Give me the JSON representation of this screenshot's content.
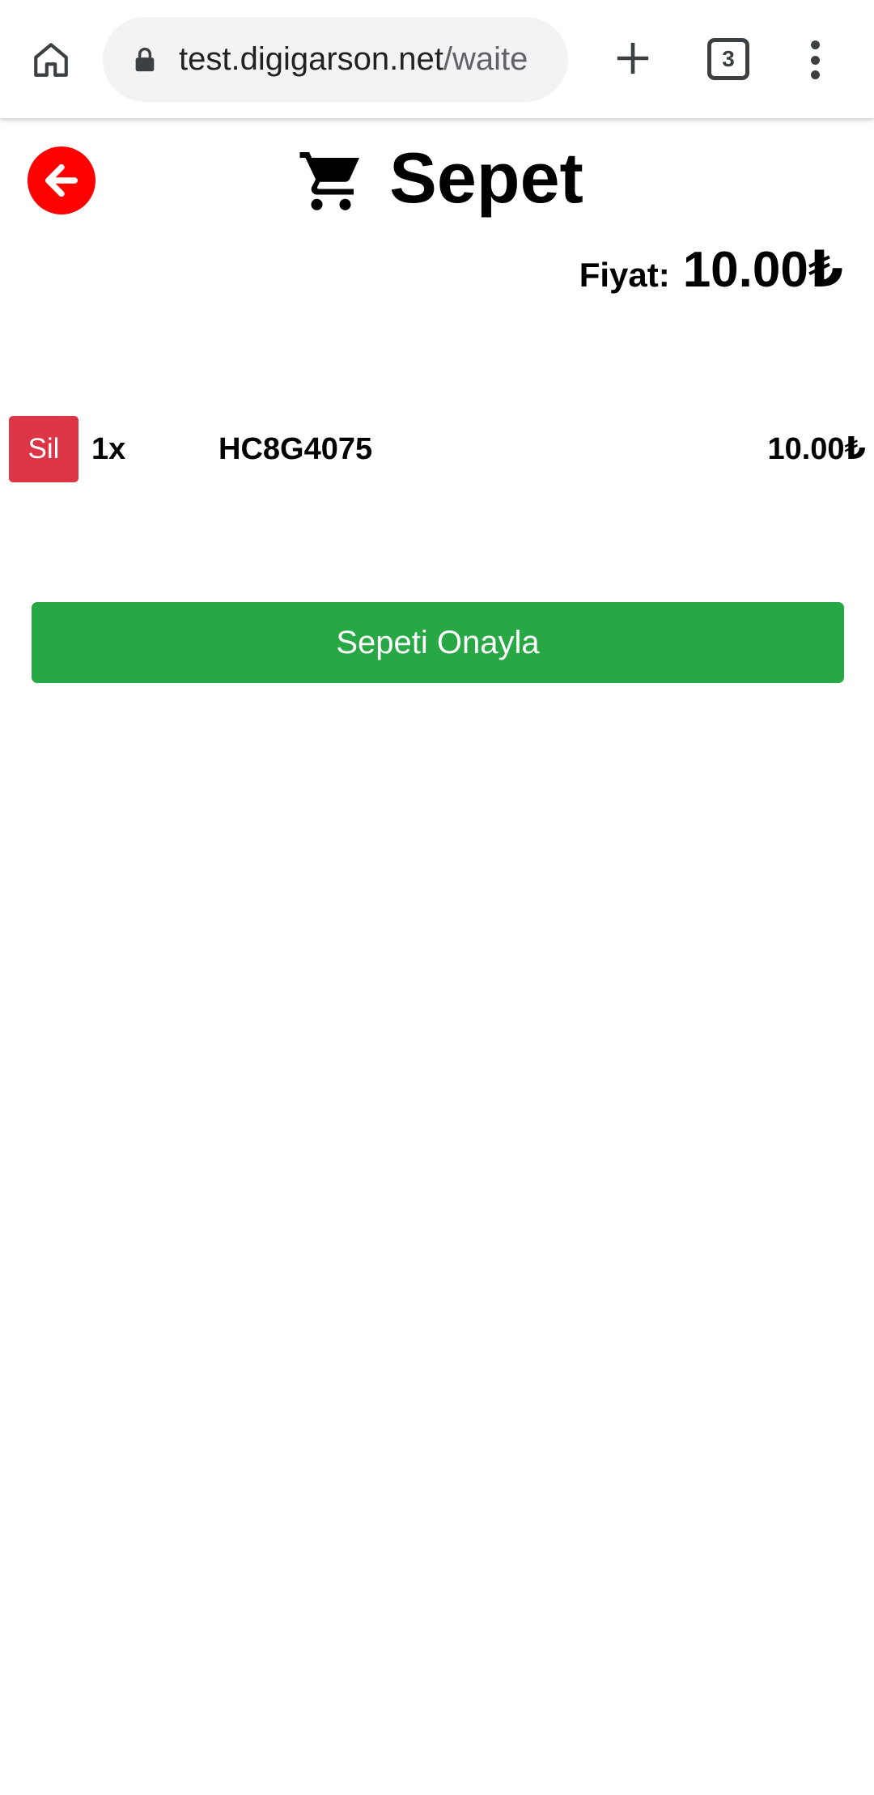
{
  "browser": {
    "url_host": "test.digigarson.net",
    "url_path": "/waite",
    "tab_count": "3",
    "icons": {
      "home": "home-icon",
      "lock": "lock-icon",
      "new_tab": "plus-icon",
      "menu": "more-vert-icon"
    }
  },
  "page": {
    "title": "Sepet",
    "back_icon": "arrow-left-icon",
    "cart_icon": "shopping-cart-icon",
    "price_label": "Fiyat:",
    "price_value": "10.00₺"
  },
  "cart": {
    "items": [
      {
        "delete_label": "Sil",
        "quantity": "1x",
        "name": "HC8G4075",
        "price": "10.00₺"
      }
    ]
  },
  "actions": {
    "confirm_label": "Sepeti Onayla"
  },
  "colors": {
    "back_button": "#ff0000",
    "delete_button": "#dc3545",
    "confirm_button": "#28a745",
    "url_bar": "#f1f3f4"
  }
}
